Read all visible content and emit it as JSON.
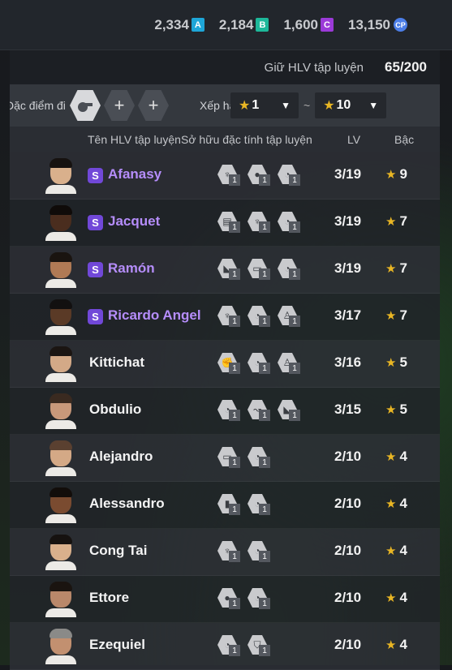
{
  "currencies": [
    {
      "amount": "2,334",
      "badge": "A",
      "color": "#1ea6d8",
      "icon": "a-token-icon"
    },
    {
      "amount": "2,184",
      "badge": "B",
      "color": "#1db89a",
      "icon": "b-token-icon"
    },
    {
      "amount": "1,600",
      "badge": "C",
      "color": "#9b3ad8",
      "icon": "c-token-icon"
    },
    {
      "amount": "13,150",
      "badge": "CP",
      "color": "#4c7ee8",
      "icon": "cp-coin-icon"
    }
  ],
  "capacity": {
    "label": "Giữ HLV tập luyện",
    "value": "65/200"
  },
  "filter": {
    "trait_label": "Đặc điểm đi",
    "rank_label": "Xếp hạ",
    "rank_min": "1",
    "rank_max": "10",
    "separator": "~"
  },
  "columns": {
    "name": "Tên HLV tập luyện",
    "traits": "Sở hữu đặc tính tập luyện",
    "lv": "LV",
    "grade": "Bậc"
  },
  "special_badge": "S",
  "coaches": [
    {
      "name": "Afanasy",
      "special": true,
      "traits": [
        "trophy-trait-icon",
        "ball-trait-icon",
        "whistle-trait-icon"
      ],
      "trait_levels": [
        "1",
        "1",
        "1"
      ],
      "lv": "3/19",
      "grade": "9",
      "skin": "#d9b08c",
      "hair": "#161210"
    },
    {
      "name": "Jacquet",
      "special": true,
      "traits": [
        "board-trait-icon",
        "trophy-trait-icon",
        "whistle-trait-icon"
      ],
      "trait_levels": [
        "1",
        "1",
        "1"
      ],
      "lv": "3/19",
      "grade": "7",
      "skin": "#4a2d1e",
      "hair": "#0f0b09"
    },
    {
      "name": "Ramón",
      "special": true,
      "traits": [
        "boot-trait-icon",
        "goal-trait-icon",
        "whistle-trait-icon"
      ],
      "trait_levels": [
        "1",
        "1",
        "1"
      ],
      "lv": "3/19",
      "grade": "7",
      "skin": "#b07a55",
      "hair": "#1a1410"
    },
    {
      "name": "Ricardo Angel",
      "special": true,
      "traits": [
        "trophy-trait-icon",
        "whistle-trait-icon",
        "shirt-trait-icon"
      ],
      "trait_levels": [
        "1",
        "1",
        "1"
      ],
      "lv": "3/17",
      "grade": "7",
      "skin": "#5a3a26",
      "hair": "#121010"
    },
    {
      "name": "Kittichat",
      "special": false,
      "traits": [
        "muscle-trait-icon",
        "whistle-trait-icon",
        "shirt-trait-icon"
      ],
      "trait_levels": [
        "1",
        "1",
        "1"
      ],
      "lv": "3/16",
      "grade": "5",
      "skin": "#d3a987",
      "hair": "#1b1512"
    },
    {
      "name": "Obdulio",
      "special": false,
      "traits": [
        "whistle-trait-icon",
        "tactic-trait-icon",
        "boot-trait-icon"
      ],
      "trait_levels": [
        "1",
        "1",
        "1"
      ],
      "lv": "3/15",
      "grade": "5",
      "skin": "#c8987a",
      "hair": "#3a2a20"
    },
    {
      "name": "Alejandro",
      "special": false,
      "traits": [
        "goal-trait-icon",
        "whistle-trait-icon"
      ],
      "trait_levels": [
        "1",
        "1"
      ],
      "lv": "2/10",
      "grade": "4",
      "skin": "#d4a986",
      "hair": "#5a4030"
    },
    {
      "name": "Alessandro",
      "special": false,
      "traits": [
        "bottle-trait-icon",
        "whistle-trait-icon"
      ],
      "trait_levels": [
        "1",
        "1"
      ],
      "lv": "2/10",
      "grade": "4",
      "skin": "#7a4b30",
      "hair": "#120d0a"
    },
    {
      "name": "Cong Tai",
      "special": false,
      "traits": [
        "trophy-trait-icon",
        "whistle-trait-icon"
      ],
      "trait_levels": [
        "1",
        "1"
      ],
      "lv": "2/10",
      "grade": "4",
      "skin": "#d9b08c",
      "hair": "#161210"
    },
    {
      "name": "Ettore",
      "special": false,
      "traits": [
        "ball-trait-icon",
        "whistle-trait-icon"
      ],
      "trait_levels": [
        "1",
        "1"
      ],
      "lv": "2/10",
      "grade": "4",
      "skin": "#b9886a",
      "hair": "#1a1410"
    },
    {
      "name": "Ezequiel",
      "special": false,
      "traits": [
        "whistle-trait-icon",
        "shield-trait-icon"
      ],
      "trait_levels": [
        "1",
        "1"
      ],
      "lv": "2/10",
      "grade": "4",
      "skin": "#c29070",
      "hair": "#8a8a88"
    }
  ]
}
